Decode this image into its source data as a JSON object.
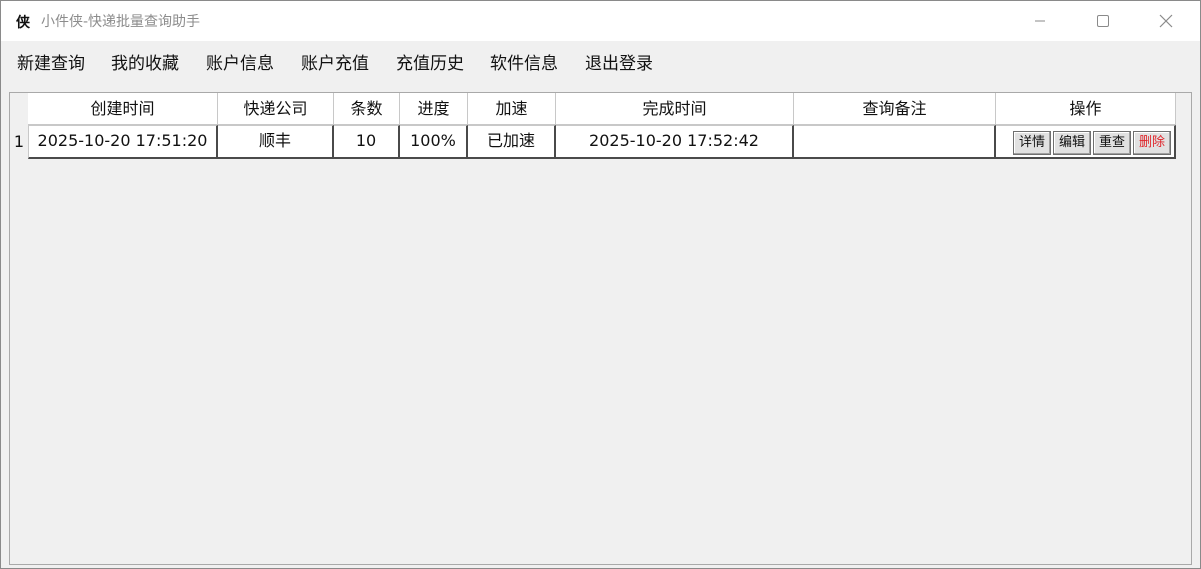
{
  "window": {
    "icon_char": "侠",
    "title": "小件侠-快递批量查询助手"
  },
  "menu": {
    "items": [
      {
        "label": "新建查询"
      },
      {
        "label": "我的收藏"
      },
      {
        "label": "账户信息"
      },
      {
        "label": "账户充值"
      },
      {
        "label": "充值历史"
      },
      {
        "label": "软件信息"
      },
      {
        "label": "退出登录"
      }
    ]
  },
  "table": {
    "columns": [
      "创建时间",
      "快递公司",
      "条数",
      "进度",
      "加速",
      "完成时间",
      "查询备注",
      "操作"
    ],
    "rows": [
      {
        "num": "1",
        "created": "2025-10-20 17:51:20",
        "company": "顺丰",
        "count": "10",
        "progress": "100%",
        "speedup": "已加速",
        "finished": "2025-10-20 17:52:42",
        "note": ""
      }
    ],
    "actions": {
      "detail": "详情",
      "edit": "编辑",
      "requery": "重查",
      "delete": "删除"
    }
  },
  "colors": {
    "delete_text": "#e0242a",
    "title_text": "#8c8c8c"
  }
}
